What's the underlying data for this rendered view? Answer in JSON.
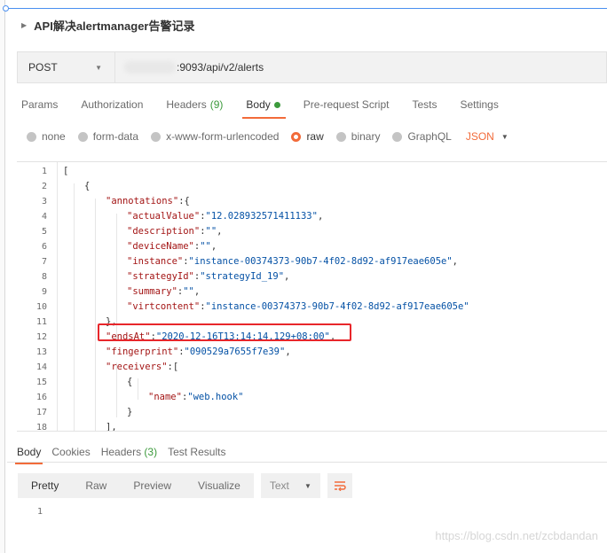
{
  "request": {
    "title": "API解决alertmanager告警记录",
    "method": "POST",
    "url_visible": ":9093/api/v2/alerts"
  },
  "tabs": [
    {
      "label": "Params"
    },
    {
      "label": "Authorization"
    },
    {
      "label": "Headers",
      "count": "(9)"
    },
    {
      "label": "Body",
      "active": true
    },
    {
      "label": "Pre-request Script"
    },
    {
      "label": "Tests"
    },
    {
      "label": "Settings"
    }
  ],
  "body_types": {
    "options": [
      "none",
      "form-data",
      "x-www-form-urlencoded",
      "raw",
      "binary",
      "GraphQL"
    ],
    "selected": "raw",
    "format": "JSON"
  },
  "editor": {
    "lines": [
      {
        "n": "1",
        "text": "["
      },
      {
        "n": "2",
        "text": "{"
      },
      {
        "n": "3",
        "key": "\"annotations\"",
        "rest": ":{"
      },
      {
        "n": "4",
        "key": "\"actualValue\"",
        "val": "\"12.028932571411133\"",
        "tail": ","
      },
      {
        "n": "5",
        "key": "\"description\"",
        "val": "\"\"",
        "tail": ","
      },
      {
        "n": "6",
        "key": "\"deviceName\"",
        "val": "\"\"",
        "tail": ","
      },
      {
        "n": "7",
        "key": "\"instance\"",
        "val": "\"instance-00374373-90b7-4f02-8d92-af917eae605e\"",
        "tail": ","
      },
      {
        "n": "8",
        "key": "\"strategyId\"",
        "val": "\"strategyId_19\"",
        "tail": ","
      },
      {
        "n": "9",
        "key": "\"summary\"",
        "val": "\"\"",
        "tail": ","
      },
      {
        "n": "10",
        "key": "\"virtcontent\"",
        "val": "\"instance-00374373-90b7-4f02-8d92-af917eae605e\"",
        "tail": ""
      },
      {
        "n": "11",
        "text": "},"
      },
      {
        "n": "12",
        "key": "\"endsAt\"",
        "val": "\"2020-12-16T13:14:14.129+08:00\"",
        "tail": ","
      },
      {
        "n": "13",
        "key": "\"fingerprint\"",
        "val": "\"090529a7655f7e39\"",
        "tail": ","
      },
      {
        "n": "14",
        "key": "\"receivers\"",
        "rest": ":["
      },
      {
        "n": "15",
        "text": "{"
      },
      {
        "n": "16",
        "key": "\"name\"",
        "val": "\"web.hook\"",
        "tail": ""
      },
      {
        "n": "17",
        "text": "}"
      },
      {
        "n": "18",
        "text": "],"
      }
    ]
  },
  "response": {
    "tabs": [
      {
        "label": "Body",
        "active": true
      },
      {
        "label": "Cookies"
      },
      {
        "label": "Headers",
        "count": "(3)"
      },
      {
        "label": "Test Results"
      }
    ],
    "views": [
      "Pretty",
      "Raw",
      "Preview",
      "Visualize"
    ],
    "active_view": "Pretty",
    "text_format": "Text",
    "line_1": "1"
  },
  "watermark": "https://blog.csdn.net/zcbdandan",
  "colors": {
    "accent": "#f26b3a",
    "key": "#a31515",
    "string": "#0451a5",
    "count": "#3c9a3c",
    "highlight": "#e8262b"
  }
}
